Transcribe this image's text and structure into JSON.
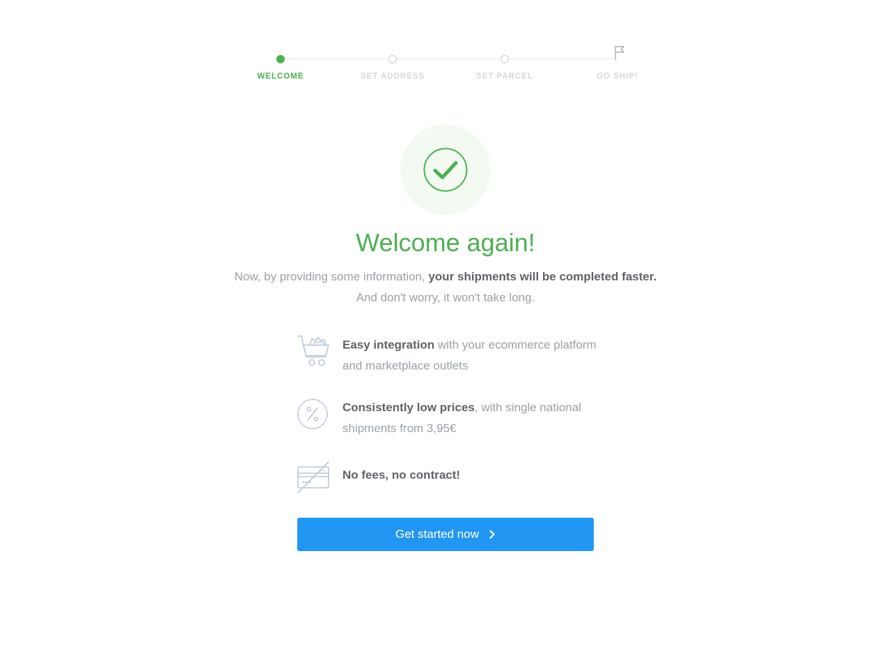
{
  "stepper": {
    "steps": [
      {
        "label": "WELCOME",
        "state": "active"
      },
      {
        "label": "SET ADDRESS",
        "state": "pending"
      },
      {
        "label": "SET PARCEL",
        "state": "pending"
      },
      {
        "label": "GO SHIP!",
        "state": "pending",
        "icon": "flag-icon"
      }
    ]
  },
  "hero": {
    "icon": "check-circle-icon",
    "title": "Welcome again!",
    "intro_part1": "Now, by providing some information, ",
    "intro_bold": "your shipments will be completed faster.",
    "intro_line2": "And don't worry, it won't take long."
  },
  "features": [
    {
      "icon": "shopping-cart-icon",
      "bold": "Easy integration",
      "text": " with your ecommerce platform and marketplace outlets"
    },
    {
      "icon": "discount-badge-icon",
      "bold": "Consistently low prices",
      "text": ", with single national shipments from 3,95€"
    },
    {
      "icon": "no-credit-card-icon",
      "bold": "No fees, no contract!",
      "text": ""
    }
  ],
  "cta": {
    "label": "Get started now",
    "icon": "chevron-right-icon"
  },
  "colors": {
    "accent_green": "#4cb050",
    "primary_blue": "#2196f3",
    "muted_text": "#9aa0a6",
    "strong_text": "#5f6368",
    "inactive_label": "#d3d7dc",
    "icon_stroke": "#b9c6dc"
  }
}
